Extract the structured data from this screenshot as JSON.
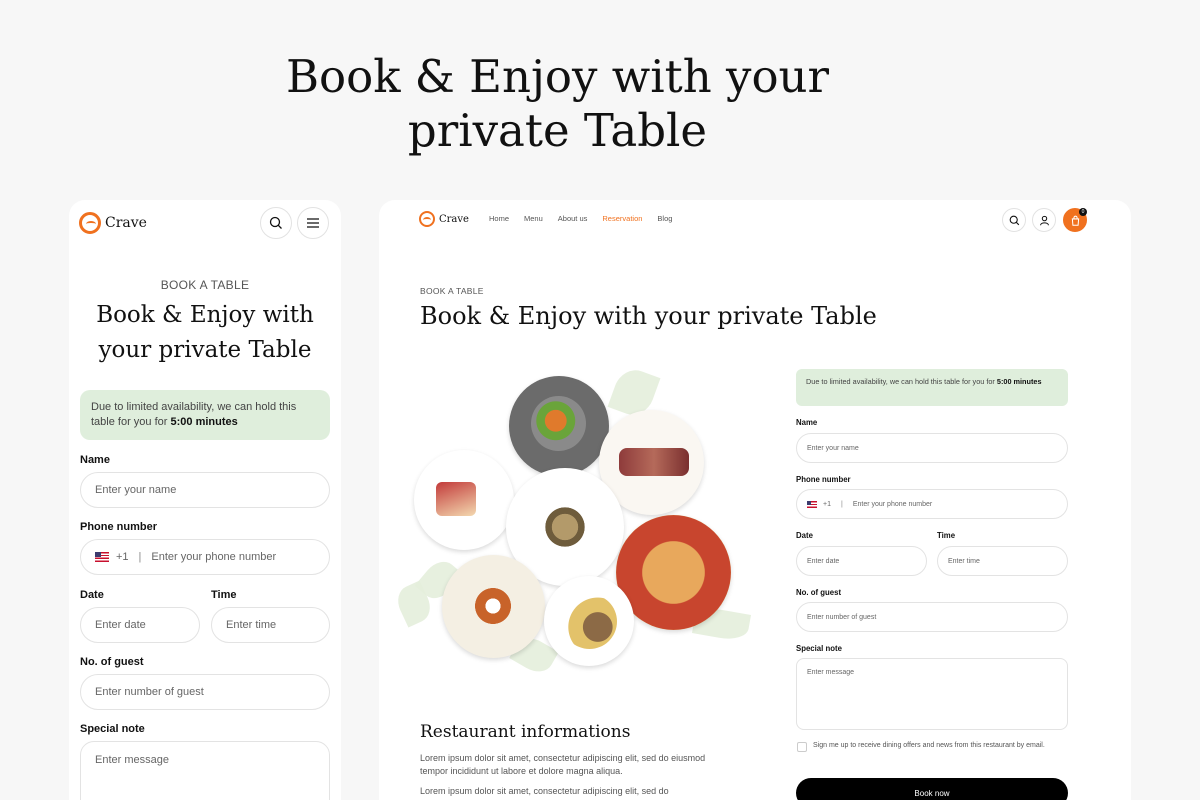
{
  "hero": {
    "line1": "Book & Enjoy with your",
    "line2": "private Table"
  },
  "mobile": {
    "brand": "Crave",
    "eyebrow": "BOOK A TABLE",
    "title_line1": "Book & Enjoy with",
    "title_line2": "your private Table",
    "notice_text": "Due to limited availability, we can hold this table for you for ",
    "notice_time": "5:00 minutes",
    "fields": {
      "name_label": "Name",
      "name_placeholder": "Enter your name",
      "phone_label": "Phone number",
      "phone_code": "+1",
      "phone_sep": "|",
      "phone_placeholder": "Enter your phone number",
      "date_label": "Date",
      "date_placeholder": "Enter date",
      "time_label": "Time",
      "time_placeholder": "Enter time",
      "guest_label": "No. of guest",
      "guest_placeholder": "Enter number of guest",
      "note_label": "Special note",
      "note_placeholder": "Enter message"
    }
  },
  "desktop": {
    "brand": "Crave",
    "nav": [
      "Home",
      "Menu",
      "About us",
      "Reservation",
      "Blog"
    ],
    "active_nav": "Reservation",
    "cart_count": "0",
    "eyebrow": "BOOK A TABLE",
    "title": "Book & Enjoy with your private Table",
    "notice_text": "Due to limited availability, we can hold this table for you for ",
    "notice_time": "5:00 minutes",
    "fields": {
      "name_label": "Name",
      "name_placeholder": "Enter your name",
      "phone_label": "Phone number",
      "phone_code": "+1",
      "phone_sep": "|",
      "phone_placeholder": "Enter your phone number",
      "date_label": "Date",
      "date_placeholder": "Enter date",
      "time_label": "Time",
      "time_placeholder": "Enter time",
      "guest_label": "No. of guest",
      "guest_placeholder": "Enter number of guest",
      "note_label": "Special note",
      "note_placeholder": "Enter message"
    },
    "checkbox_label": "Sign me up to receive dining offers and news from this restaurant by email.",
    "book_button": "Book now",
    "section_title": "Restaurant informations",
    "para1": "Lorem ipsum dolor sit amet, consectetur adipiscing elit, sed do eiusmod tempor incididunt ut labore et dolore magna aliqua.",
    "para2": "Lorem ipsum dolor sit amet, consectetur adipiscing elit, sed do"
  },
  "colors": {
    "accent": "#f0711f",
    "notice_bg": "#dfeedc",
    "button_bg": "#000000"
  }
}
